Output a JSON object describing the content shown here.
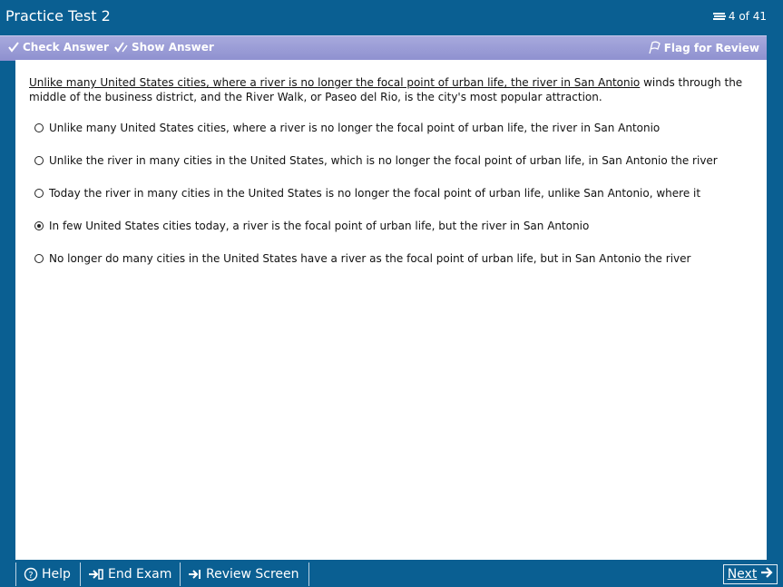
{
  "window": {
    "title": "Practice Test 2",
    "counter": "4 of 41"
  },
  "toolbar": {
    "check_answer": "Check Answer",
    "show_answer": "Show Answer",
    "flag_review": "Flag for Review"
  },
  "question": {
    "underlined": "Unlike many United States cities, where a river is no longer the focal point of urban life, the river in San Antonio",
    "rest": " winds through the middle of the business district, and the River Walk, or Paseo del Rio, is the city's most popular attraction."
  },
  "options": [
    {
      "label": "Unlike many United States cities, where a river is no longer the focal point of urban life, the river in San Antonio",
      "selected": false
    },
    {
      "label": "Unlike the river in many cities in the United States, which is no longer the focal point of urban life, in San Antonio the river",
      "selected": false
    },
    {
      "label": "Today the river in many cities in the United States is no longer the focal point of urban life, unlike San Antonio, where it",
      "selected": false
    },
    {
      "label": "In few United States cities today, a river is the focal point of urban life, but the river in San Antonio",
      "selected": true
    },
    {
      "label": "No longer do many cities in the United States have a river as the focal point of urban life, but in San Antonio the river",
      "selected": false
    }
  ],
  "footer": {
    "help": "Help",
    "end_exam": "End Exam",
    "review_screen": "Review Screen",
    "next": "Next"
  },
  "colors": {
    "frame": "#0a5f92",
    "toolbar": "#9a9cd6",
    "content_bg": "#ffffff"
  },
  "icons": {
    "counter": "stack-icon",
    "check": "check-pen-icon",
    "show": "show-answer-icon",
    "flag": "flag-icon",
    "help": "help-circle-icon",
    "end": "end-exam-icon",
    "review": "review-arrow-icon",
    "next": "arrow-right-icon"
  }
}
